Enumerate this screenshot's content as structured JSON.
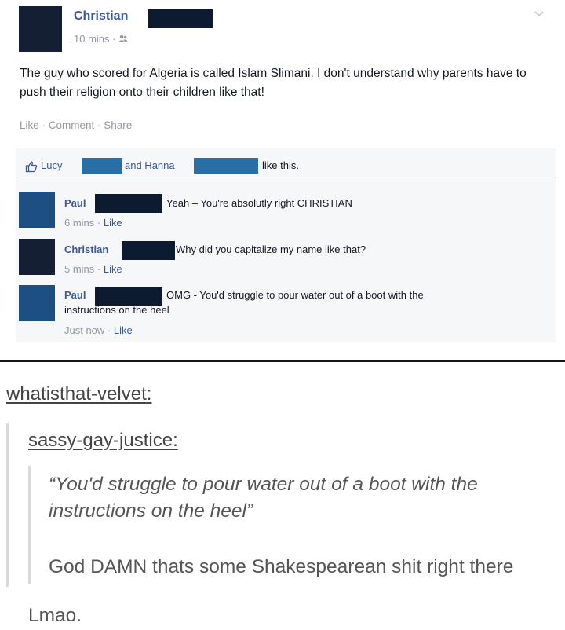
{
  "post": {
    "author": "Christian",
    "time": "10 mins",
    "text": "The guy who scored for Algeria is called Islam Slimani. I don't understand why parents have to push their religion onto their children like that!",
    "actions": "Like · Comment · Share",
    "likes": {
      "name1": "Lucy",
      "connector": "and Hanna",
      "suffix": "like this."
    }
  },
  "comments": [
    {
      "name": "Paul",
      "text": "Yeah – You're absolutly right CHRISTIAN",
      "time": "6 mins",
      "like": "Like"
    },
    {
      "name": "Christian",
      "text": "Why did you capitalize my name like that?",
      "time": "5 mins",
      "like": "Like"
    },
    {
      "name": "Paul",
      "text": "OMG - You'd struggle to pour water out of a boot with the",
      "text2": "instructions on the heel",
      "time": "Just now",
      "like": "Like"
    }
  ],
  "tumblr": {
    "reblogger": "whatisthat-velvet",
    "op": "sassy-gay-justice",
    "quote": "“You'd struggle to pour water out of a boot with the instructions on the heel”",
    "op_comment": "God DAMN thats some Shakespearean shit right there",
    "reblog_comment": "Lmao."
  },
  "colors": {
    "fb_link": "#3b5998",
    "redaction": "#0d1b31",
    "avatar_blue": "#1e4f82",
    "muted": "#9197a3"
  },
  "icons": [
    "friends-icon",
    "chevron-down-icon",
    "thumbs-up-icon"
  ]
}
